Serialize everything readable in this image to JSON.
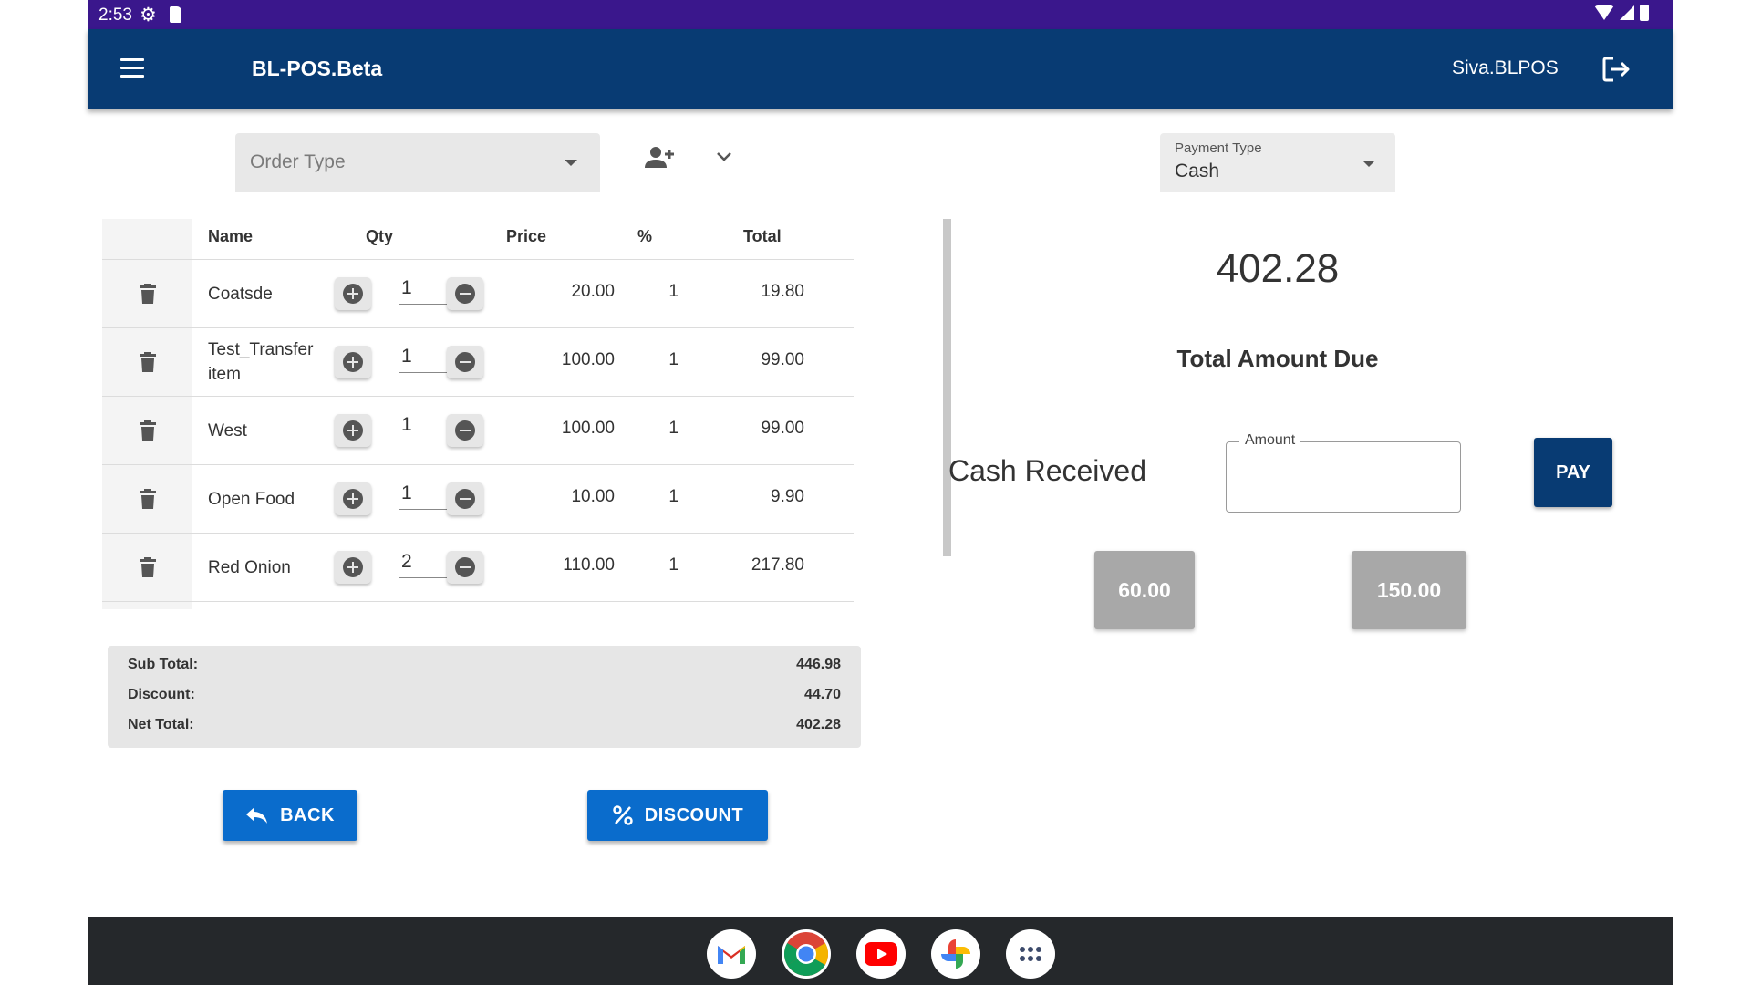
{
  "status_bar": {
    "time": "2:53"
  },
  "app_bar": {
    "title": "BL-POS.Beta",
    "user": "Siva.BLPOS"
  },
  "order": {
    "order_type_placeholder": "Order Type"
  },
  "payment": {
    "type_label": "Payment Type",
    "type_value": "Cash",
    "amount_due": "402.28",
    "due_label": "Total Amount Due",
    "cash_received_label": "Cash Received",
    "amount_label": "Amount",
    "pay_label": "PAY",
    "quick_amounts": [
      "60.00",
      "150.00"
    ]
  },
  "table": {
    "headers": {
      "name": "Name",
      "qty": "Qty",
      "price": "Price",
      "percent": "%",
      "total": "Total"
    },
    "rows": [
      {
        "name": "Coatsde",
        "qty": "1",
        "price": "20.00",
        "percent": "1",
        "total": "19.80"
      },
      {
        "name": "Test_Transfer item",
        "qty": "1",
        "price": "100.00",
        "percent": "1",
        "total": "99.00"
      },
      {
        "name": "West",
        "qty": "1",
        "price": "100.00",
        "percent": "1",
        "total": "99.00"
      },
      {
        "name": "Open Food",
        "qty": "1",
        "price": "10.00",
        "percent": "1",
        "total": "9.90"
      },
      {
        "name": "Red Onion",
        "qty": "2",
        "price": "110.00",
        "percent": "1",
        "total": "217.80"
      }
    ]
  },
  "totals": {
    "sub_total_label": "Sub Total:",
    "sub_total": "446.98",
    "discount_label": "Discount:",
    "discount": "44.70",
    "net_total_label": "Net Total:",
    "net_total": "402.28"
  },
  "actions": {
    "back_label": "BACK",
    "discount_label": "DISCOUNT"
  },
  "colors": {
    "status_bar": "#3a178c",
    "app_bar": "#083b73",
    "primary_button": "#0a6ccc",
    "quick_button": "#a8a8a8",
    "taskbar": "#25282b"
  },
  "taskbar_apps": [
    "gmail-icon",
    "chrome-icon",
    "youtube-icon",
    "photos-icon",
    "app-launcher-icon"
  ]
}
